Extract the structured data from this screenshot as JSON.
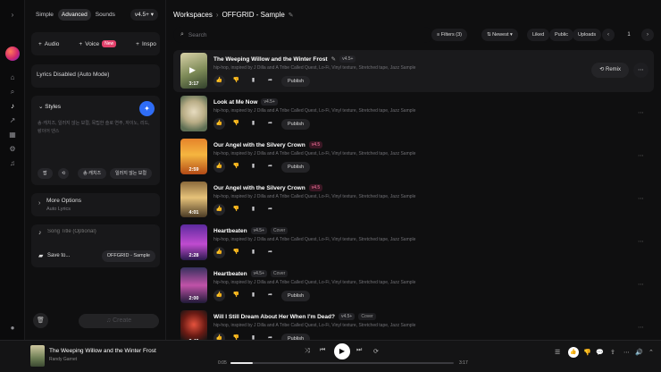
{
  "modes": [
    {
      "label": "Simple",
      "active": false
    },
    {
      "label": "Advanced",
      "active": true
    },
    {
      "label": "Sounds",
      "active": false
    }
  ],
  "version_select": "v4.5+",
  "add_chips": [
    {
      "label": "Audio",
      "badge": ""
    },
    {
      "label": "Voice",
      "badge": "New"
    },
    {
      "label": "Inspo",
      "badge": ""
    }
  ],
  "lyrics_mode": "Lyrics Disabled (Auto Mode)",
  "styles": {
    "title": "Styles",
    "text": "송·캐치즈, 일러지 않는 보컬, 목팁한 슬로 연주, 자이노, 리드, 랑이어 댄스",
    "tag1": "팝",
    "tag2": "송·캐치즈",
    "tag3": "일러지 않는 보컬"
  },
  "more_options": {
    "title": "More Options",
    "sub": "Auto Lyrics"
  },
  "song_title_placeholder": "Song Title (Optional)",
  "save_to": {
    "label": "Save to...",
    "value": "OFFGRID - Sample"
  },
  "create_label": "Create",
  "breadcrumb": {
    "root": "Workspaces",
    "current": "OFFGRID - Sample"
  },
  "search_placeholder": "Search",
  "filters": {
    "filters_label": "Filters (3)",
    "sort_label": "Newest",
    "liked": "Liked",
    "public": "Public",
    "uploads": "Uploads",
    "page": "1"
  },
  "songs": [
    {
      "title": "The Weeping Willow and the Winter Frost",
      "version": "v4.5+",
      "cover": "",
      "desc": "hip-hop, inspired by J Dilla and A Tribe Called Quest, Lo-Fi, Vinyl texture, Stretched tape, Jazz Sample",
      "duration": "3:17",
      "publish": "Publish",
      "remix": "Remix",
      "highlight": true,
      "pink": false,
      "thumb": "linear-gradient(160deg,#d9d2a8,#7d8a57 55%,#31402b)"
    },
    {
      "title": "Look at Me Now",
      "version": "v4.5+",
      "cover": "",
      "desc": "hip-hop, inspired by J Dilla and A Tribe Called Quest, Lo-Fi, Vinyl texture, Stretched tape, Jazz Sample",
      "duration": "",
      "publish": "Publish",
      "remix": "",
      "highlight": false,
      "pink": false,
      "thumb": "radial-gradient(circle at 50% 45%,#e7dcc0,#b9ad86 45%,#5d6e53 80%)"
    },
    {
      "title": "Our Angel with the Silvery Crown",
      "version": "v4.5",
      "cover": "",
      "desc": "hip-hop, inspired by J Dilla and A Tribe Called Quest, Lo-Fi, Vinyl texture, Stretched tape, Jazz Sample",
      "duration": "2:59",
      "publish": "Publish",
      "remix": "",
      "highlight": false,
      "pink": true,
      "thumb": "linear-gradient(180deg,#e5832a,#f5b640 45%,#b24a16)"
    },
    {
      "title": "Our Angel with the Silvery Crown",
      "version": "v4.5",
      "cover": "",
      "desc": "hip-hop, inspired by J Dilla and A Tribe Called Quest, Lo-Fi, Vinyl texture, Stretched tape, Jazz Sample",
      "duration": "4:01",
      "publish": "",
      "remix": "",
      "highlight": false,
      "pink": true,
      "thumb": "linear-gradient(180deg,#8a6a3c,#e6c27a 45%,#4a3a24)"
    },
    {
      "title": "Heartbeaten",
      "version": "v4.5+",
      "cover": "Cover",
      "desc": "hip-hop, inspired by J Dilla and A Tribe Called Quest, Lo-Fi, Vinyl texture, Stretched tape, Jazz Sample",
      "duration": "2:28",
      "publish": "",
      "remix": "",
      "highlight": false,
      "pink": false,
      "thumb": "linear-gradient(180deg,#5b2a9e,#c04bd0 55%,#2b1a4e)"
    },
    {
      "title": "Heartbeaten",
      "version": "v4.5+",
      "cover": "Cover",
      "desc": "hip-hop, inspired by J Dilla and A Tribe Called Quest, Lo-Fi, Vinyl texture, Stretched tape, Jazz Sample",
      "duration": "2:00",
      "publish": "Publish",
      "remix": "",
      "highlight": false,
      "pink": false,
      "thumb": "linear-gradient(180deg,#37315e,#c052a8 50%,#201a38)"
    },
    {
      "title": "Will I Still Dream About Her When I'm Dead?",
      "version": "v4.5+",
      "cover": "Cover",
      "desc": "hip-hop, inspired by J Dilla and A Tribe Called Quest, Lo-Fi, Vinyl texture, Stretched tape, Jazz Sample",
      "duration": "2:46",
      "publish": "Publish",
      "remix": "",
      "highlight": false,
      "pink": false,
      "thumb": "radial-gradient(circle at 50% 40%,#e5523d,#6b1b14 45%,#141414 80%)"
    }
  ],
  "player": {
    "title": "The Weeping Willow and the Winter Frost",
    "artist": "Randy Garnet",
    "elapsed": "0:05",
    "total": "3:17",
    "progress": 0.1
  }
}
